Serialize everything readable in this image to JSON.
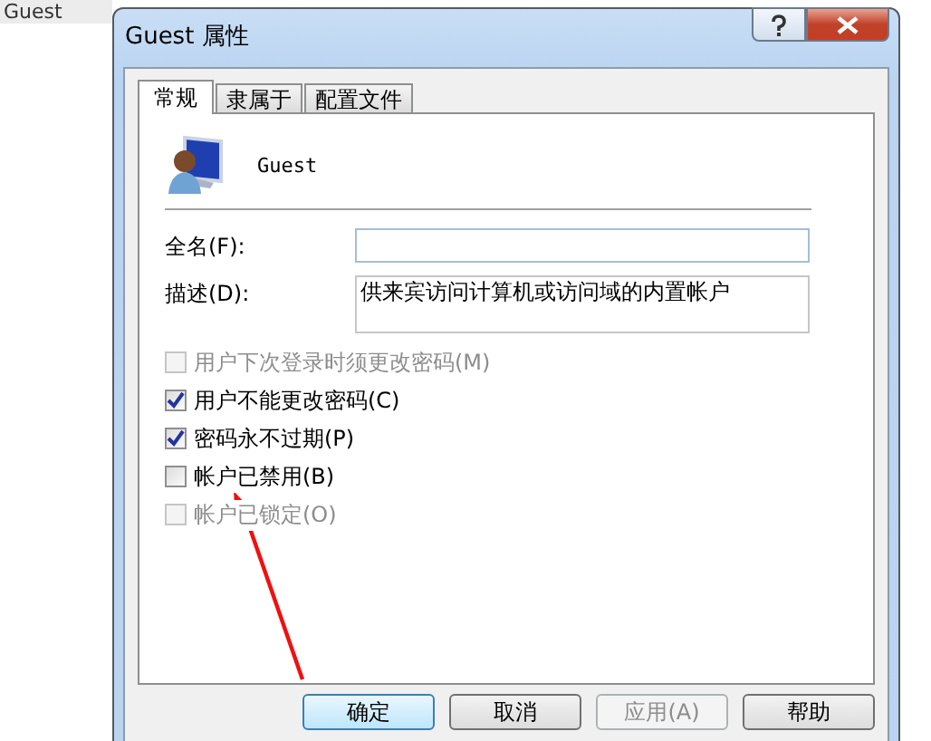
{
  "background": {
    "list_item": "Guest"
  },
  "window": {
    "title": "Guest 属性"
  },
  "tabs": [
    {
      "label": "常规",
      "selected": true
    },
    {
      "label": "隶属于",
      "selected": false
    },
    {
      "label": "配置文件",
      "selected": false
    }
  ],
  "user": {
    "name": "Guest"
  },
  "fields": [
    {
      "label": "全名(F):"
    },
    {
      "label": "描述(D):",
      "value": "供来宾访问计算机或访问域的内置帐户"
    }
  ],
  "checkboxes": [
    {
      "label": "用户下次登录时须更改密码(M)",
      "checked": false,
      "disabled": true
    },
    {
      "label": "用户不能更改密码(C)",
      "checked": true,
      "disabled": false
    },
    {
      "label": "密码永不过期(P)",
      "checked": true,
      "disabled": false
    },
    {
      "label": "帐户已禁用(B)",
      "checked": false,
      "disabled": false
    },
    {
      "label": "帐户已锁定(O)",
      "checked": false,
      "disabled": true
    }
  ],
  "buttons": [
    {
      "label": "确定",
      "disabled": false,
      "default": true
    },
    {
      "label": "取消",
      "disabled": false,
      "default": false
    },
    {
      "label": "应用(A)",
      "disabled": true,
      "default": false
    },
    {
      "label": "帮助",
      "disabled": false,
      "default": false
    }
  ]
}
